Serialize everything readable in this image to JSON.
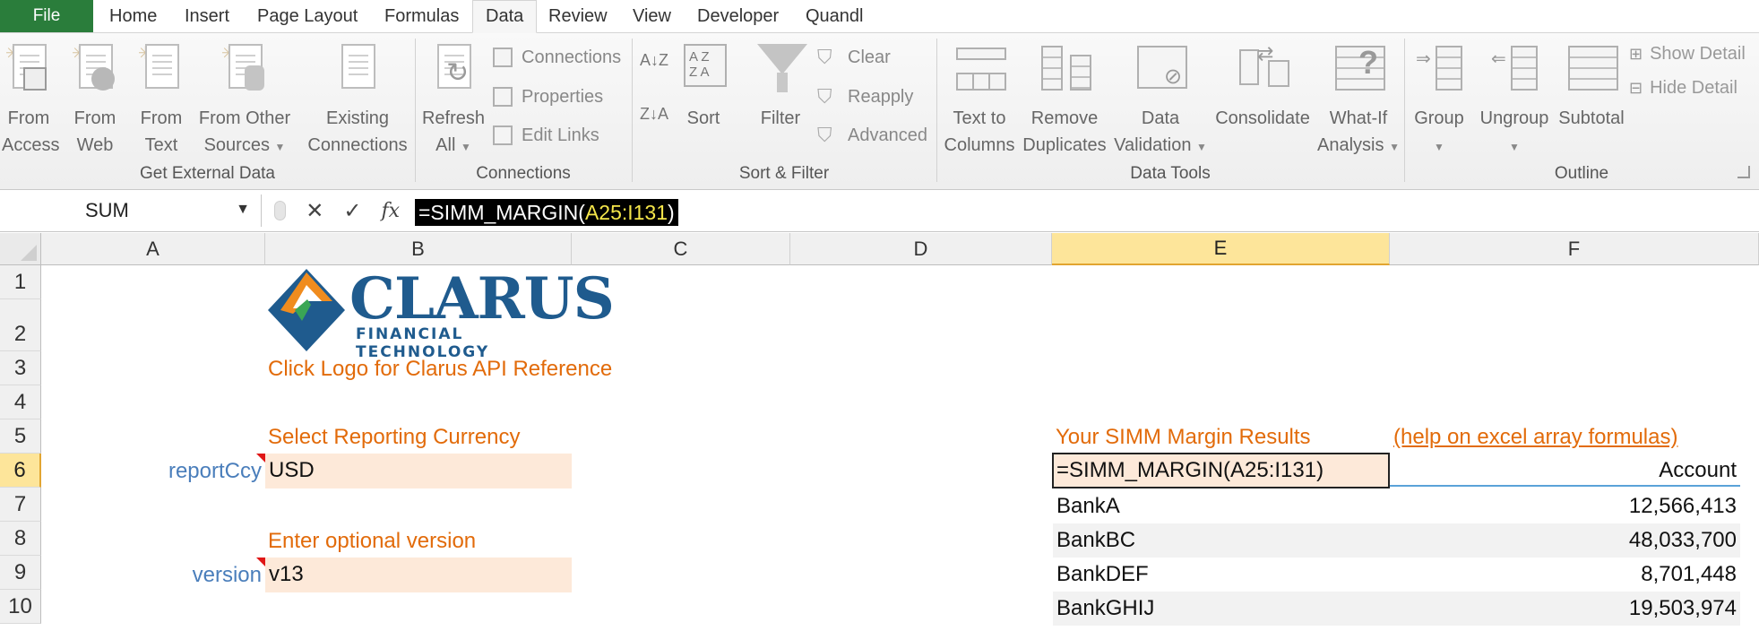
{
  "tabs": {
    "file": "File",
    "items": [
      "Home",
      "Insert",
      "Page Layout",
      "Formulas",
      "Data",
      "Review",
      "View",
      "Developer",
      "Quandl"
    ],
    "active": "Data"
  },
  "ribbon": {
    "get_external": {
      "label": "Get External Data",
      "from_access": [
        "From",
        "Access"
      ],
      "from_web": [
        "From",
        "Web"
      ],
      "from_text": [
        "From",
        "Text"
      ],
      "from_other": [
        "From Other",
        "Sources"
      ],
      "existing": [
        "Existing",
        "Connections"
      ]
    },
    "connections": {
      "label": "Connections",
      "refresh": [
        "Refresh",
        "All"
      ],
      "connections": "Connections",
      "properties": "Properties",
      "edit_links": "Edit Links"
    },
    "sort_filter": {
      "label": "Sort & Filter",
      "sort": "Sort",
      "filter": "Filter",
      "clear": "Clear",
      "reapply": "Reapply",
      "advanced": "Advanced"
    },
    "data_tools": {
      "label": "Data Tools",
      "text_to_columns": [
        "Text to",
        "Columns"
      ],
      "remove_duplicates": [
        "Remove",
        "Duplicates"
      ],
      "data_validation": [
        "Data",
        "Validation"
      ],
      "consolidate": "Consolidate",
      "what_if": [
        "What-If",
        "Analysis"
      ]
    },
    "outline": {
      "label": "Outline",
      "group": "Group",
      "ungroup": "Ungroup",
      "subtotal": "Subtotal",
      "show_detail": "Show Detail",
      "hide_detail": "Hide Detail"
    }
  },
  "formula_bar": {
    "name_box": "SUM",
    "formula_prefix": "=SIMM_MARGIN(",
    "formula_ref": "A25:I131",
    "formula_suffix": ")"
  },
  "columns": [
    "A",
    "B",
    "C",
    "D",
    "E",
    "F"
  ],
  "rows": [
    "1",
    "2",
    "3",
    "4",
    "5",
    "6",
    "7",
    "8",
    "9",
    "10"
  ],
  "logo": {
    "name": "CLARUS",
    "tagline": "FINANCIAL TECHNOLOGY"
  },
  "sheet": {
    "api_ref": "Click Logo for Clarus API Reference",
    "select_ccy_label": "Select Reporting Currency",
    "report_ccy_name": "reportCcy",
    "report_ccy_value": "USD",
    "version_label": "Enter optional version",
    "version_name": "version",
    "version_value": "v13",
    "results_title": "Your SIMM Margin Results",
    "help_link": "(help on excel array formulas)",
    "edit_formula": "=SIMM_MARGIN(A25:I131)",
    "account_header": "Account",
    "results": [
      {
        "name": "BankA",
        "value": "12,566,413"
      },
      {
        "name": "BankBC",
        "value": "48,033,700"
      },
      {
        "name": "BankDEF",
        "value": "8,701,448"
      },
      {
        "name": "BankGHIJ",
        "value": "19,503,974"
      }
    ]
  },
  "colors": {
    "file_tab": "#2a7d3b",
    "orange_text": "#e26b0a",
    "blue_label": "#4a7ebb",
    "input_fill": "#fde9d9",
    "selected_header": "#fde59a",
    "logo_blue": "#1f5b8e"
  }
}
